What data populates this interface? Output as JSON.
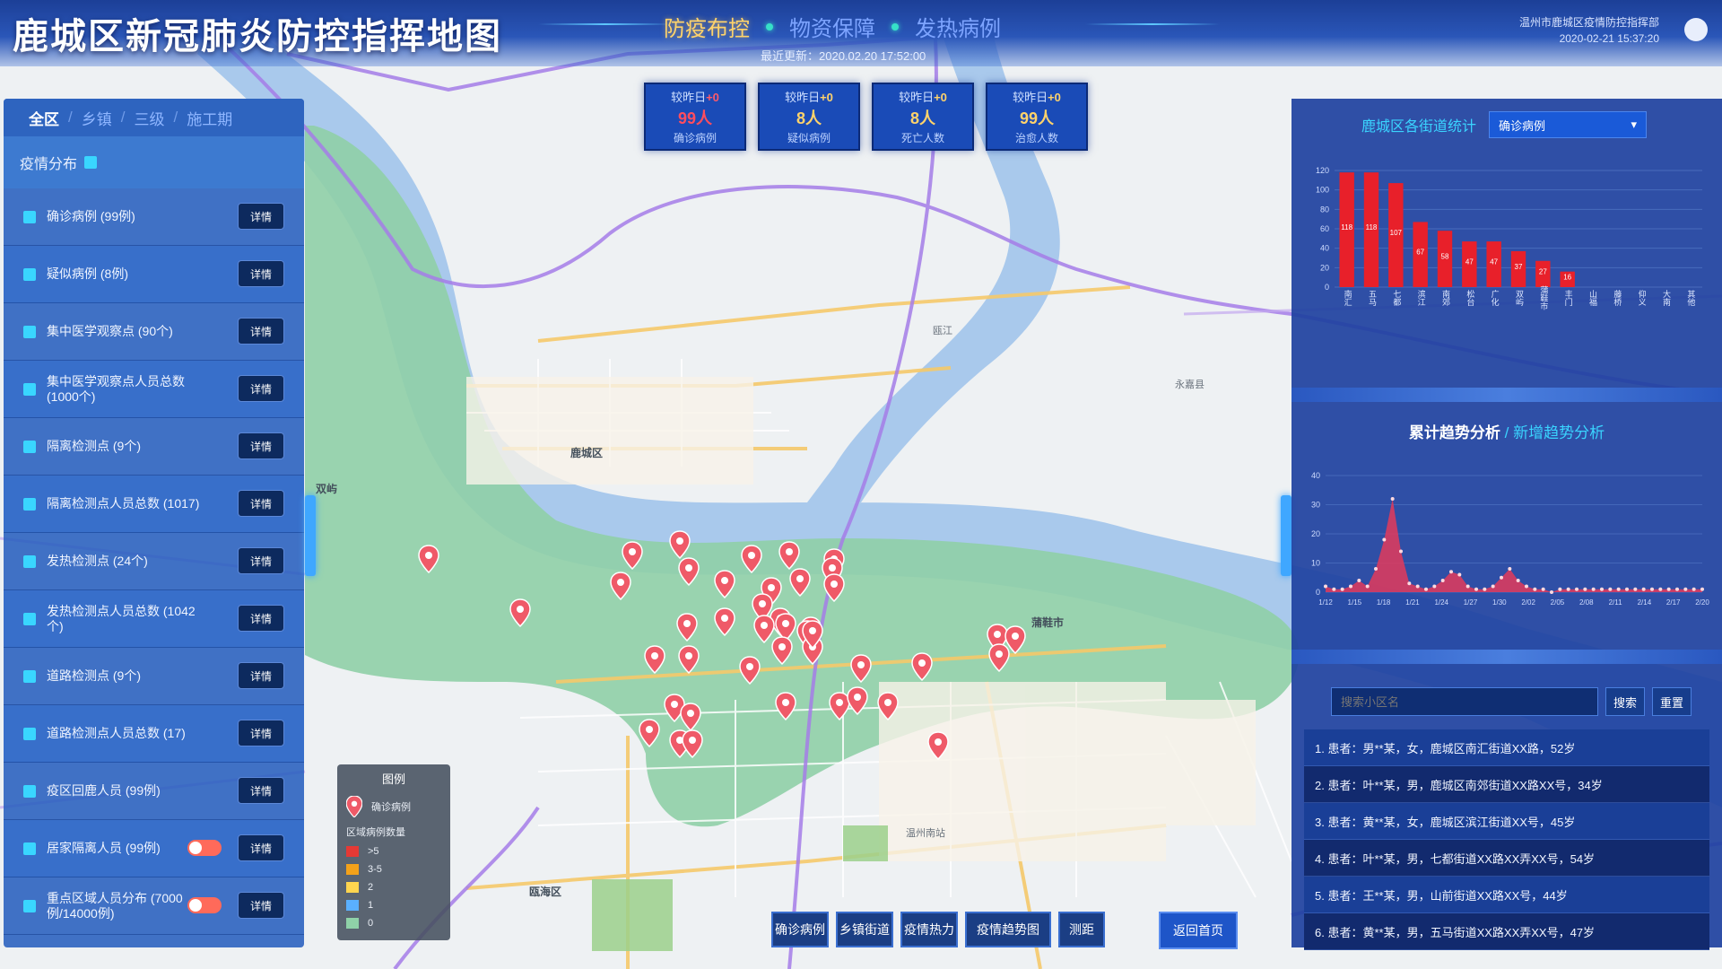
{
  "header": {
    "title": "鹿城区新冠肺炎防控指挥地图",
    "nav": [
      "防疫布控",
      "物资保障",
      "发热病例"
    ],
    "updated": "最近更新：2020.02.20 17:52:00",
    "right_line1": "温州市鹿城区疫情防控指挥部",
    "right_line2": "2020-02-21 15:37:20"
  },
  "stats": [
    {
      "l1_prefix": "较昨日",
      "l1_change": "+0",
      "value": "99人",
      "label": "确诊病例"
    },
    {
      "l1_prefix": "较昨日",
      "l1_change": "+0",
      "value": "8人",
      "label": "疑似病例"
    },
    {
      "l1_prefix": "较昨日",
      "l1_change": "+0",
      "value": "8人",
      "label": "死亡人数"
    },
    {
      "l1_prefix": "较昨日",
      "l1_change": "+0",
      "value": "99人",
      "label": "治愈人数"
    }
  ],
  "left_panel": {
    "crumbs": [
      "全区",
      "乡镇",
      "三级",
      "施工期"
    ],
    "section_title": "疫情分布",
    "detail_label": "详情",
    "layers": [
      {
        "label": "确诊病例 (99例)",
        "toggle": false
      },
      {
        "label": "疑似病例 (8例)",
        "toggle": false
      },
      {
        "label": "集中医学观察点 (90个)",
        "toggle": false
      },
      {
        "label": "集中医学观察点人员总数 (1000个)",
        "toggle": false
      },
      {
        "label": "隔离检测点 (9个)",
        "toggle": false
      },
      {
        "label": "隔离检测点人员总数 (1017)",
        "toggle": false
      },
      {
        "label": "发热检测点 (24个)",
        "toggle": false
      },
      {
        "label": "发热检测点人员总数 (1042个)",
        "toggle": false
      },
      {
        "label": "道路检测点 (9个)",
        "toggle": false
      },
      {
        "label": "道路检测点人员总数 (17)",
        "toggle": false
      },
      {
        "label": "疫区回鹿人员 (99例)",
        "toggle": false
      },
      {
        "label": "居家隔离人员 (99例)",
        "toggle": true
      },
      {
        "label": "重点区域人员分布 (7000例/14000例)",
        "toggle": true
      }
    ]
  },
  "legend": {
    "title": "图例",
    "pin_label": "确诊病例",
    "range_title": "区域病例数量",
    "ranges": [
      ">5",
      "3-5",
      "2",
      "1",
      "0"
    ],
    "colors": [
      "#e53935",
      "#f4a21a",
      "#ffd54f",
      "#5ab0ff",
      "#8fd1a8"
    ]
  },
  "toolbar": {
    "buttons": [
      "确诊病例",
      "乡镇街道",
      "疫情热力",
      "疫情趋势图",
      "测距"
    ],
    "right_button": "返回首页"
  },
  "right_panel": {
    "bar_title": "鹿城区各街道统计",
    "bar_select": "确诊病例",
    "line_title_a": "累计趋势分析",
    "line_title_b": "新增趋势分析",
    "search_placeholder": "搜索小区名",
    "search_btn": "搜索",
    "reset_btn": "重置",
    "cases": [
      "1. 患者：男**某，女，鹿城区南汇街道XX路，52岁",
      "2. 患者：叶**某，男，鹿城区南郊街道XX路XX号，34岁",
      "3. 患者：黄**某，女，鹿城区滨江街道XX号，45岁",
      "4. 患者：叶**某，男，七都街道XX路XX弄XX号，54岁",
      "5. 患者：王**某，男，山前街道XX路XX号，44岁",
      "6. 患者：黄**某，男，五马街道XX路XX弄XX号，47岁"
    ]
  },
  "chart_data": [
    {
      "type": "bar",
      "categories": [
        "南汇",
        "五马",
        "七都",
        "滨江",
        "南郊",
        "松台",
        "广化",
        "双屿",
        "蒲鞋市",
        "丰门",
        "山福",
        "藤桥",
        "仰义",
        "大南",
        "其他"
      ],
      "values": [
        118,
        118,
        107,
        67,
        58,
        47,
        47,
        37,
        27,
        16,
        0,
        0,
        0,
        0,
        0
      ],
      "ylim": [
        0,
        120
      ],
      "yticks": [
        0,
        20,
        40,
        60,
        80,
        100,
        120
      ],
      "color": "#e8202a"
    },
    {
      "type": "area",
      "x": [
        "1/12",
        "1/15",
        "1/18",
        "1/21",
        "1/24",
        "1/27",
        "1/30",
        "2/02",
        "2/05",
        "2/08",
        "2/11",
        "2/14",
        "2/17",
        "2/20"
      ],
      "values": [
        2,
        1,
        1,
        2,
        4,
        2,
        8,
        18,
        32,
        14,
        3,
        2,
        1,
        2,
        4,
        7,
        6,
        2,
        1,
        1,
        2,
        5,
        8,
        4,
        2,
        1,
        1,
        0,
        1,
        1,
        1,
        1,
        1,
        1,
        1,
        1,
        1,
        1,
        1,
        1,
        1,
        1,
        1,
        1,
        1,
        1
      ],
      "ylim": [
        0,
        40
      ],
      "yticks": [
        0,
        10,
        20,
        30,
        40
      ],
      "color": "#e33a5a"
    }
  ]
}
